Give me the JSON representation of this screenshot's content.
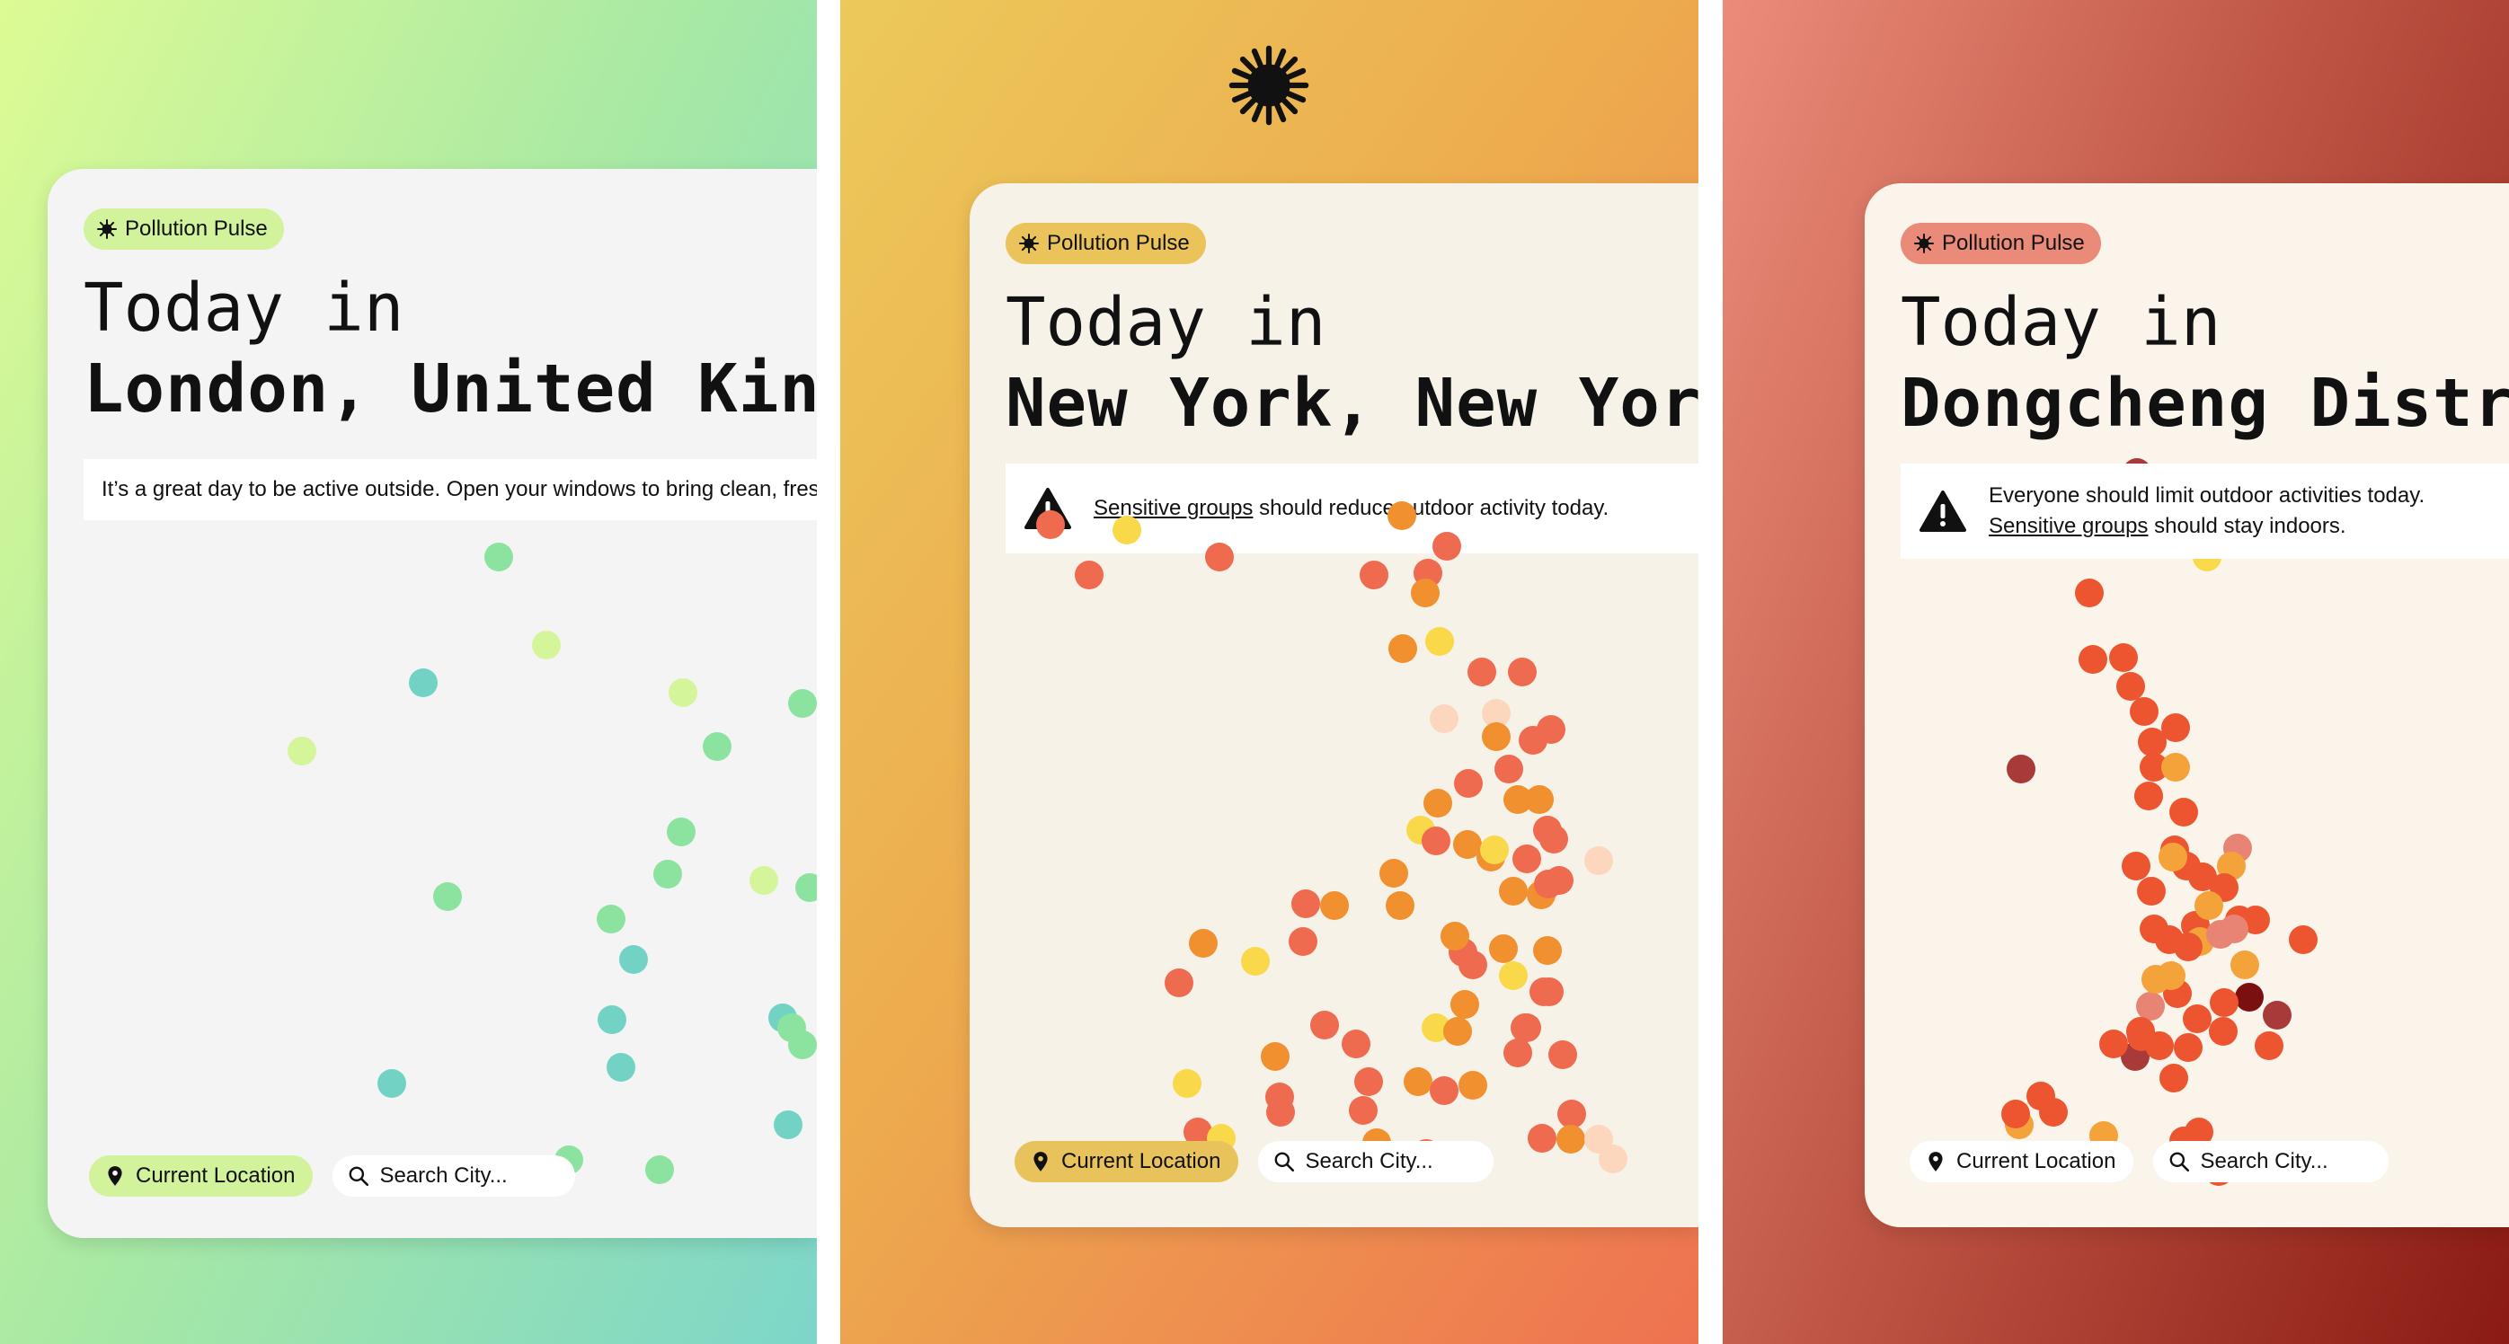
{
  "panels": [
    {
      "brand": "Pollution Pulse",
      "headline_line1": "Today in",
      "headline_line2": "London, United Kingdom",
      "message": "It’s a great day to be active outside. Open your windows to bring clean, fresh air indoors.",
      "current_location_label": "Current Location",
      "search_placeholder": "Search City...",
      "accent_color": "#d2f29c",
      "dot_colors": [
        "#8ce3a0",
        "#d5f59b",
        "#72d3c5"
      ]
    },
    {
      "brand": "Pollution Pulse",
      "headline_line1": "Today in",
      "headline_line2": "New York, New York",
      "message_link": "Sensitive groups",
      "message_rest": " should reduce outdoor activity today.",
      "warning_icon": "warning-triangle-icon",
      "current_location_label": "Current Location",
      "search_placeholder": "Search City...",
      "accent_color": "#eac35a",
      "dot_colors": [
        "#ef6b50",
        "#f0902f",
        "#f9d84a",
        "#fcd6bd"
      ]
    },
    {
      "brand": "Pollution Pulse",
      "headline_line1": "Today in",
      "headline_line2": "Dongcheng District",
      "message_text": "Everyone should limit outdoor activities today. ",
      "message_link": "Sensitive groups",
      "message_rest": " should stay indoors.",
      "warning_icon": "warning-triangle-icon",
      "current_location_label": "Current Location",
      "search_placeholder": "Search City...",
      "accent_color": "#ea8b7a",
      "dot_colors": [
        "#ec5530",
        "#f3a33a",
        "#f9da4c",
        "#a83a3a",
        "#e78473",
        "#7b1010"
      ]
    }
  ],
  "icons": {
    "sun": "sun-icon",
    "pin": "location-pin-icon",
    "search": "search-icon"
  }
}
